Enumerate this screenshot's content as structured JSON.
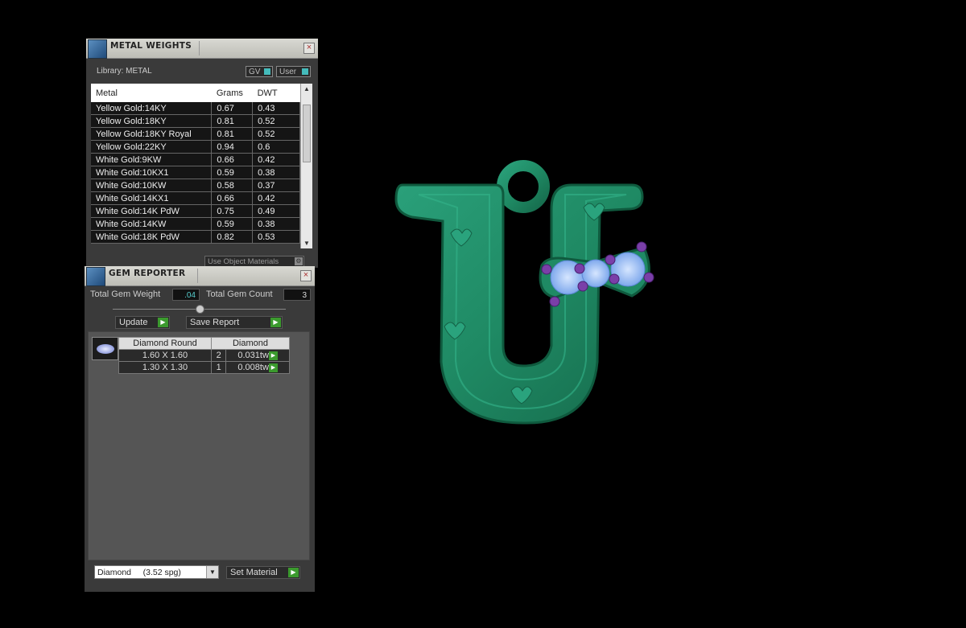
{
  "metal_weights": {
    "title": "METAL WEIGHTS",
    "library_label": "Library: METAL",
    "gv_toggle": "GV",
    "user_toggle": "User",
    "columns": [
      "Metal",
      "Grams",
      "DWT"
    ],
    "rows": [
      [
        "Yellow Gold:14KY",
        "0.67",
        "0.43"
      ],
      [
        "Yellow Gold:18KY",
        "0.81",
        "0.52"
      ],
      [
        "Yellow Gold:18KY Royal",
        "0.81",
        "0.52"
      ],
      [
        "Yellow Gold:22KY",
        "0.94",
        "0.6"
      ],
      [
        "White Gold:9KW",
        "0.66",
        "0.42"
      ],
      [
        "White Gold:10KX1",
        "0.59",
        "0.38"
      ],
      [
        "White Gold:10KW",
        "0.58",
        "0.37"
      ],
      [
        "White Gold:14KX1",
        "0.66",
        "0.42"
      ],
      [
        "White Gold:14K PdW",
        "0.75",
        "0.49"
      ],
      [
        "White Gold:14KW",
        "0.59",
        "0.38"
      ],
      [
        "White Gold:18K PdW",
        "0.82",
        "0.53"
      ]
    ],
    "use_object_materials": "Use Object Materials"
  },
  "gem_reporter": {
    "title": "GEM REPORTER",
    "total_weight_label": "Total Gem Weight",
    "total_weight_value": ".04",
    "total_count_label": "Total Gem Count",
    "total_count_value": "3",
    "update_label": "Update",
    "save_report_label": "Save Report",
    "gem_columns": [
      "Diamond Round",
      "Diamond"
    ],
    "gem_rows": [
      {
        "size": "1.60 X 1.60",
        "count": "2",
        "weight": "0.031tw"
      },
      {
        "size": "1.30 X 1.30",
        "count": "1",
        "weight": "0.008tw"
      }
    ],
    "material_select": "Diamond     (3.52 spg)",
    "set_material_label": "Set Material"
  },
  "colors": {
    "model_green": "#1f8a64",
    "gem_blue": "#8fb8f0",
    "prong_purple": "#7a3fa8",
    "accent_go": "#3b9a2e"
  }
}
